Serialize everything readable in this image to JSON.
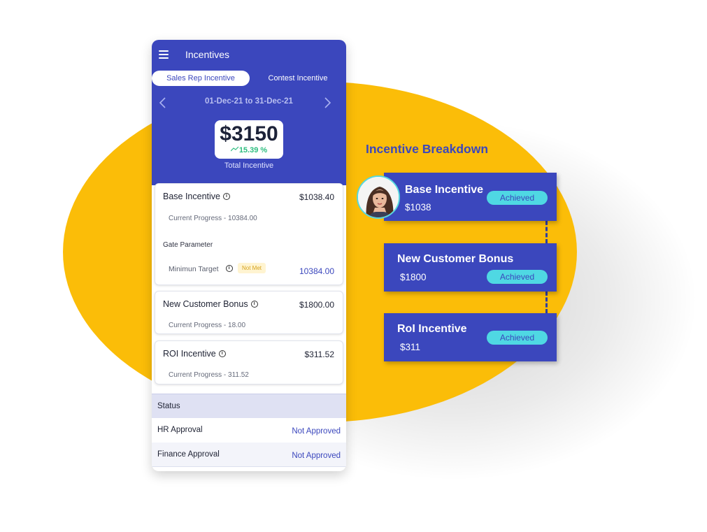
{
  "colors": {
    "primary": "#3b47bd",
    "accent_yellow": "#fbbd08",
    "success": "#2dbd7f",
    "badge_cyan": "#4fd8e3",
    "card_blue": "#3b47bd"
  },
  "app": {
    "title": "Incentives",
    "menu_icon": "hamburger-menu-icon"
  },
  "tabs": [
    {
      "label": "Sales Rep Incentive",
      "active": true
    },
    {
      "label": "Contest Incentive",
      "active": false
    }
  ],
  "date_range": {
    "label": "01-Dec-21 to 31-Dec-21",
    "prev_icon": "chevron-left-icon",
    "next_icon": "chevron-right-icon"
  },
  "total": {
    "amount": "$3150",
    "change": "15.39 %",
    "label": "Total Incentive",
    "trend_icon": "trend-up-icon"
  },
  "incentives": [
    {
      "name": "Base Incentive",
      "amount": "$1038.40",
      "progress": "Current Progress - 10384.00"
    },
    {
      "name": "New Customer Bonus",
      "amount": "$1800.00",
      "progress": "Current Progress - 18.00"
    },
    {
      "name": "ROI Incentive",
      "amount": "$311.52",
      "progress": "Current Progress - 311.52"
    }
  ],
  "gate": {
    "title": "Gate Parameter",
    "min_label": "Minimun Target",
    "badge": "Not Met",
    "target": "10384.00"
  },
  "info_glyph": "i",
  "status": {
    "header": "Status",
    "rows": [
      {
        "label": "HR Approval",
        "value": "Not Approved"
      },
      {
        "label": "Finance Approval",
        "value": "Not Approved"
      }
    ]
  },
  "breakdown": {
    "heading": "Incentive Breakdown",
    "items": [
      {
        "title": "Base Incentive",
        "amount": "$1038",
        "badge": "Achieved"
      },
      {
        "title": "New Customer Bonus",
        "amount": "$1800",
        "badge": "Achieved"
      },
      {
        "title": "RoI Incentive",
        "amount": "$311",
        "badge": "Achieved"
      }
    ]
  }
}
